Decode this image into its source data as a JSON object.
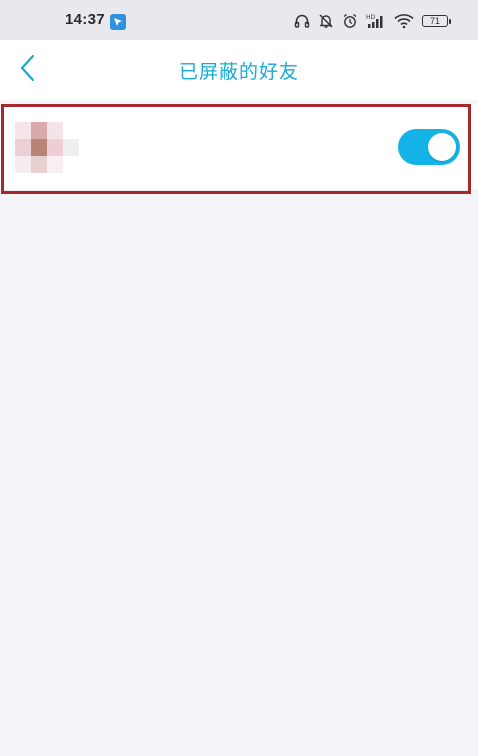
{
  "status_bar": {
    "time": "14:37",
    "battery_level": "71",
    "icons": [
      "app-notification-icon",
      "headphones-icon",
      "do-not-disturb-icon",
      "alarm-icon",
      "hd-signal-icon",
      "wifi-icon",
      "battery-icon"
    ]
  },
  "nav": {
    "back_icon": "chevron-left-icon",
    "title": "已屏蔽的好友"
  },
  "blocked_friends": [
    {
      "name": "",
      "avatar": "pixelated-avatar",
      "blocked": true
    }
  ],
  "colors": {
    "accent": "#1aa9d6",
    "toggle_on": "#13b3e8",
    "highlight": "#a8272c",
    "background": "#f5f4f9"
  }
}
